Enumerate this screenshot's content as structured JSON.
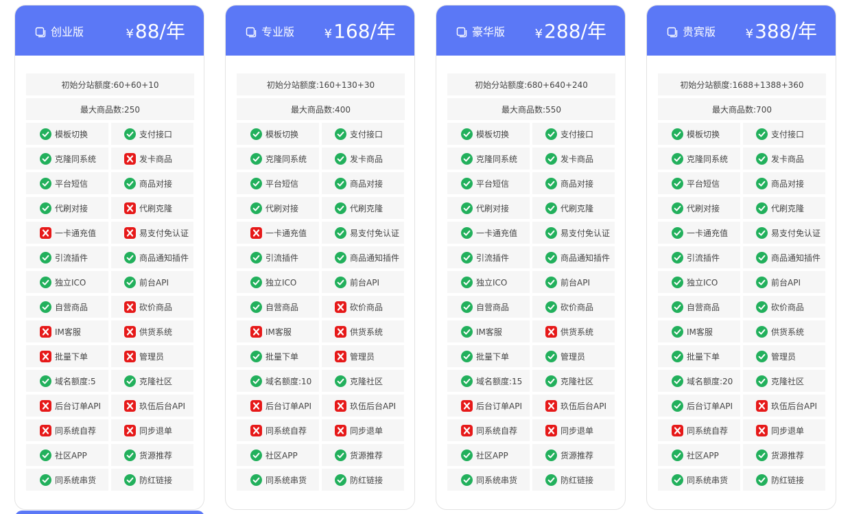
{
  "colors": {
    "header_bg": "#5b78f6",
    "check": "#22b05c",
    "cross": "#e61919",
    "cell_bg": "#f6f6f6"
  },
  "feature_pairs": [
    [
      "模板切换",
      "支付接口"
    ],
    [
      "克隆同系统",
      "发卡商品"
    ],
    [
      "平台短信",
      "商品对接"
    ],
    [
      "代刷对接",
      "代刷克隆"
    ],
    [
      "一卡通充值",
      "易支付免认证"
    ],
    [
      "引流插件",
      "商品通知插件"
    ],
    [
      "独立ICO",
      "前台API"
    ],
    [
      "自营商品",
      "砍价商品"
    ],
    [
      "IM客服",
      "供货系统"
    ],
    [
      "批量下单",
      "管理员"
    ],
    [
      "域名额度:{n}",
      "克隆社区"
    ],
    [
      "后台订单API",
      "玖伍后台API"
    ],
    [
      "同系统自荐",
      "同步退单"
    ],
    [
      "社区APP",
      "货源推荐"
    ],
    [
      "同系统串货",
      "防红链接"
    ]
  ],
  "plans": [
    {
      "name": "创业版",
      "currency": "¥",
      "price": "88/年",
      "quota": "初始分站额度:60+60+10",
      "max_products": "最大商品数:250",
      "domain_quota": "5",
      "status": [
        [
          true,
          true
        ],
        [
          true,
          false
        ],
        [
          true,
          true
        ],
        [
          true,
          false
        ],
        [
          false,
          false
        ],
        [
          true,
          true
        ],
        [
          true,
          true
        ],
        [
          true,
          false
        ],
        [
          false,
          false
        ],
        [
          false,
          false
        ],
        [
          true,
          true
        ],
        [
          false,
          false
        ],
        [
          false,
          false
        ],
        [
          true,
          true
        ],
        [
          true,
          true
        ]
      ]
    },
    {
      "name": "专业版",
      "currency": "¥",
      "price": "168/年",
      "quota": "初始分站额度:160+130+30",
      "max_products": "最大商品数:400",
      "domain_quota": "10",
      "status": [
        [
          true,
          true
        ],
        [
          true,
          true
        ],
        [
          true,
          true
        ],
        [
          true,
          true
        ],
        [
          false,
          true
        ],
        [
          true,
          true
        ],
        [
          true,
          true
        ],
        [
          true,
          false
        ],
        [
          false,
          false
        ],
        [
          true,
          false
        ],
        [
          true,
          true
        ],
        [
          false,
          false
        ],
        [
          false,
          false
        ],
        [
          true,
          true
        ],
        [
          true,
          true
        ]
      ]
    },
    {
      "name": "豪华版",
      "currency": "¥",
      "price": "288/年",
      "quota": "初始分站额度:680+640+240",
      "max_products": "最大商品数:550",
      "domain_quota": "15",
      "status": [
        [
          true,
          true
        ],
        [
          true,
          true
        ],
        [
          true,
          true
        ],
        [
          true,
          true
        ],
        [
          true,
          true
        ],
        [
          true,
          true
        ],
        [
          true,
          true
        ],
        [
          true,
          true
        ],
        [
          true,
          false
        ],
        [
          true,
          true
        ],
        [
          true,
          true
        ],
        [
          false,
          false
        ],
        [
          false,
          false
        ],
        [
          true,
          true
        ],
        [
          true,
          true
        ]
      ]
    },
    {
      "name": "贵宾版",
      "currency": "¥",
      "price": "388/年",
      "quota": "初始分站额度:1688+1388+360",
      "max_products": "最大商品数:700",
      "domain_quota": "20",
      "status": [
        [
          true,
          true
        ],
        [
          true,
          true
        ],
        [
          true,
          true
        ],
        [
          true,
          true
        ],
        [
          true,
          true
        ],
        [
          true,
          true
        ],
        [
          true,
          true
        ],
        [
          true,
          true
        ],
        [
          true,
          true
        ],
        [
          true,
          true
        ],
        [
          true,
          true
        ],
        [
          true,
          false
        ],
        [
          false,
          false
        ],
        [
          true,
          true
        ],
        [
          true,
          true
        ]
      ]
    }
  ]
}
